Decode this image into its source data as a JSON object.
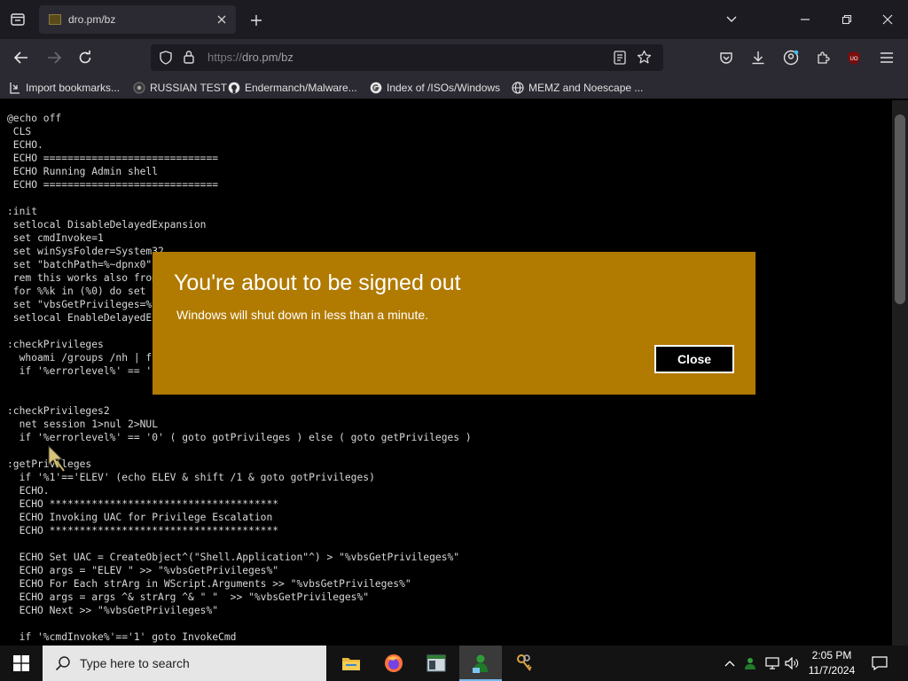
{
  "browser": {
    "tab_title": "dro.pm/bz",
    "url_protocol": "https://",
    "url_host": "dro.pm/bz",
    "bookmarks": [
      {
        "label": "Import bookmarks...",
        "icon": "import-icon"
      },
      {
        "label": "RUSSIAN TEST",
        "icon": "site-icon"
      },
      {
        "label": "Endermanch/Malware...",
        "icon": "github-icon"
      },
      {
        "label": "Index of /ISOs/Windows",
        "icon": "google-icon"
      },
      {
        "label": "MEMZ and Noescape ...",
        "icon": "globe-icon"
      }
    ]
  },
  "page": {
    "code_lines": [
      "@echo off",
      " CLS",
      " ECHO.",
      " ECHO =============================",
      " ECHO Running Admin shell",
      " ECHO =============================",
      "",
      ":init",
      " setlocal DisableDelayedExpansion",
      " set cmdInvoke=1",
      " set winSysFolder=System32",
      " set \"batchPath=%~dpnx0\"",
      " rem this works also from cmd shell, other than %~0",
      " for %%k in (%0) do set batchName=%%~nk",
      " set \"vbsGetPrivileges=%temp%\\OEgetPriv_%batchName%.vbs\"",
      " setlocal EnableDelayedExpansion",
      "",
      ":checkPrivileges",
      "  whoami /groups /nh | find \"S-1-16-12288\" >nul",
      "  if '%errorlevel%' == '0' ( goto checkPrivileges2 )",
      "",
      "",
      ":checkPrivileges2",
      "  net session 1>nul 2>NUL",
      "  if '%errorlevel%' == '0' ( goto gotPrivileges ) else ( goto getPrivileges )",
      "",
      ":getPrivileges",
      "  if '%1'=='ELEV' (echo ELEV & shift /1 & goto gotPrivileges)",
      "  ECHO.",
      "  ECHO **************************************",
      "  ECHO Invoking UAC for Privilege Escalation",
      "  ECHO **************************************",
      "",
      "  ECHO Set UAC = CreateObject^(\"Shell.Application\"^) > \"%vbsGetPrivileges%\"",
      "  ECHO args = \"ELEV \" >> \"%vbsGetPrivileges%\"",
      "  ECHO For Each strArg in WScript.Arguments >> \"%vbsGetPrivileges%\"",
      "  ECHO args = args ^& strArg ^& \" \"  >> \"%vbsGetPrivileges%\"",
      "  ECHO Next >> \"%vbsGetPrivileges%\"",
      "",
      "  if '%cmdInvoke%'=='1' goto InvokeCmd"
    ]
  },
  "dialog": {
    "title": "You're about to be signed out",
    "message": "Windows will shut down in less than a minute.",
    "close_label": "Close",
    "color": "#b17a00"
  },
  "taskbar": {
    "search_placeholder": "Type here to search",
    "time": "2:05 PM",
    "date": "11/7/2024"
  }
}
